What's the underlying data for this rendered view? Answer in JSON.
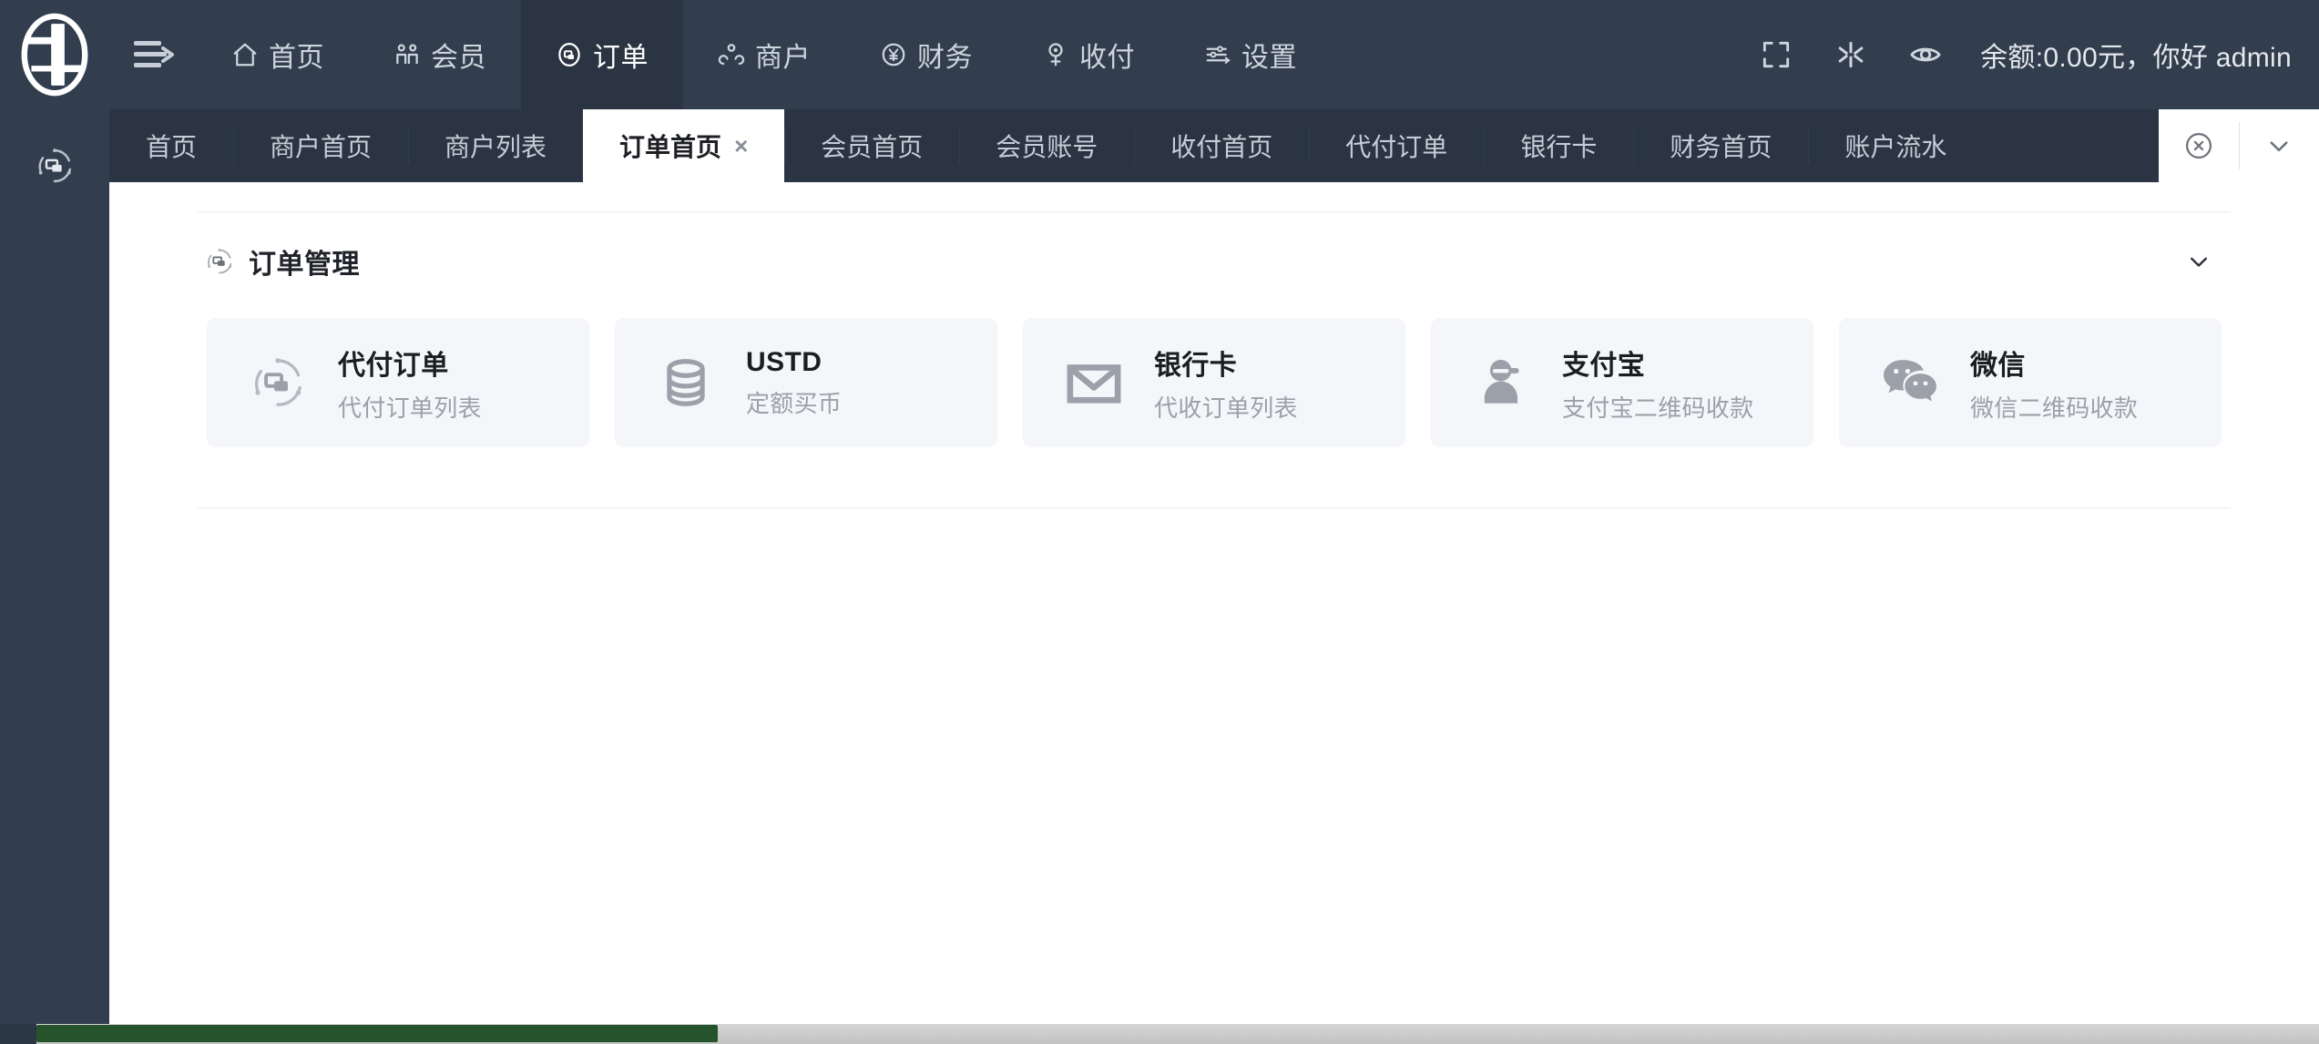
{
  "header": {
    "logo_name": "company-logo",
    "menu_toggle_label": "menu-toggle",
    "nav": [
      {
        "label": "首页",
        "icon": "home-icon",
        "active": false
      },
      {
        "label": "会员",
        "icon": "members-icon",
        "active": false
      },
      {
        "label": "订单",
        "icon": "orders-icon",
        "active": true
      },
      {
        "label": "商户",
        "icon": "merchant-icon",
        "active": false
      },
      {
        "label": "财务",
        "icon": "finance-icon",
        "active": false
      },
      {
        "label": "收付",
        "icon": "payment-icon",
        "active": false
      },
      {
        "label": "设置",
        "icon": "settings-icon",
        "active": false
      }
    ],
    "tools": [
      {
        "icon": "fullscreen-icon",
        "label": "全屏"
      },
      {
        "icon": "theme-icon",
        "label": "主题"
      },
      {
        "icon": "eye-icon",
        "label": "预览"
      }
    ],
    "balance_text": "余额:0.00元，你好 admin"
  },
  "tabs": [
    {
      "label": "首页",
      "active": false,
      "closable": false
    },
    {
      "label": "商户首页",
      "active": false,
      "closable": false
    },
    {
      "label": "商户列表",
      "active": false,
      "closable": false
    },
    {
      "label": "订单首页",
      "active": true,
      "closable": true,
      "close_glyph": "×"
    },
    {
      "label": "会员首页",
      "active": false,
      "closable": false
    },
    {
      "label": "会员账号",
      "active": false,
      "closable": false
    },
    {
      "label": "收付首页",
      "active": false,
      "closable": false
    },
    {
      "label": "代付订单",
      "active": false,
      "closable": false
    },
    {
      "label": "银行卡",
      "active": false,
      "closable": false
    },
    {
      "label": "财务首页",
      "active": false,
      "closable": false
    },
    {
      "label": "账户流水",
      "active": false,
      "closable": false
    }
  ],
  "tab_tools": {
    "close_all": "close-circle-icon",
    "dropdown": "chevron-down-icon"
  },
  "sidebar": {
    "items": [
      {
        "icon": "orders-module-icon",
        "label": "订单"
      }
    ]
  },
  "main": {
    "section": {
      "title": "订单管理",
      "icon": "orders-module-icon",
      "collapse_icon": "chevron-down-icon"
    },
    "cards": [
      {
        "title": "代付订单",
        "subtitle": "代付订单列表",
        "icon": "orders-module-icon"
      },
      {
        "title": "USTD",
        "subtitle": "定额买币",
        "icon": "database-icon"
      },
      {
        "title": "银行卡",
        "subtitle": "代收订单列表",
        "icon": "mail-icon"
      },
      {
        "title": "支付宝",
        "subtitle": "支付宝二维码收款",
        "icon": "user-icon"
      },
      {
        "title": "微信",
        "subtitle": "微信二维码收款",
        "icon": "wechat-icon"
      }
    ]
  },
  "colors": {
    "header_bg": "#323e4e",
    "header_active": "#2a3442",
    "tabbar_bg": "#2a3442",
    "tab_active_bg": "#ffffff",
    "content_bg": "#ffffff",
    "card_bg": "#f5f6f9",
    "icon_gray": "#9ba0a9",
    "scrollbar_thumb": "#25542c"
  }
}
